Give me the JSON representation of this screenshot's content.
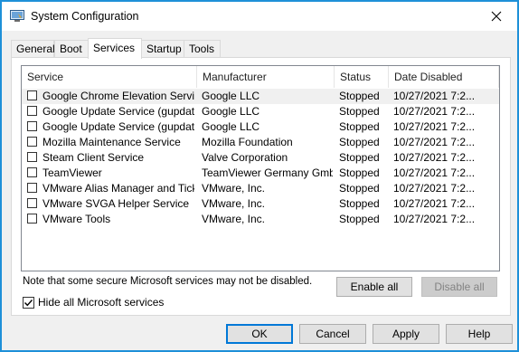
{
  "window": {
    "title": "System Configuration"
  },
  "tabs": [
    {
      "label": "General"
    },
    {
      "label": "Boot"
    },
    {
      "label": "Services"
    },
    {
      "label": "Startup"
    },
    {
      "label": "Tools"
    }
  ],
  "active_tab": "Services",
  "columns": {
    "service": "Service",
    "manufacturer": "Manufacturer",
    "status": "Status",
    "date_disabled": "Date Disabled"
  },
  "services": [
    {
      "checked": false,
      "service": "Google Chrome Elevation Servic...",
      "manufacturer": "Google LLC",
      "status": "Stopped",
      "date_disabled": "10/27/2021 7:2..."
    },
    {
      "checked": false,
      "service": "Google Update Service (gupdate)",
      "manufacturer": "Google LLC",
      "status": "Stopped",
      "date_disabled": "10/27/2021 7:2..."
    },
    {
      "checked": false,
      "service": "Google Update Service (gupdatem)",
      "manufacturer": "Google LLC",
      "status": "Stopped",
      "date_disabled": "10/27/2021 7:2..."
    },
    {
      "checked": false,
      "service": "Mozilla Maintenance Service",
      "manufacturer": "Mozilla Foundation",
      "status": "Stopped",
      "date_disabled": "10/27/2021 7:2..."
    },
    {
      "checked": false,
      "service": "Steam Client Service",
      "manufacturer": "Valve Corporation",
      "status": "Stopped",
      "date_disabled": "10/27/2021 7:2..."
    },
    {
      "checked": false,
      "service": "TeamViewer",
      "manufacturer": "TeamViewer Germany GmbH",
      "status": "Stopped",
      "date_disabled": "10/27/2021 7:2..."
    },
    {
      "checked": false,
      "service": "VMware Alias Manager and Ticke...",
      "manufacturer": "VMware, Inc.",
      "status": "Stopped",
      "date_disabled": "10/27/2021 7:2..."
    },
    {
      "checked": false,
      "service": "VMware SVGA Helper Service",
      "manufacturer": "VMware, Inc.",
      "status": "Stopped",
      "date_disabled": "10/27/2021 7:2..."
    },
    {
      "checked": false,
      "service": "VMware Tools",
      "manufacturer": "VMware, Inc.",
      "status": "Stopped",
      "date_disabled": "10/27/2021 7:2..."
    }
  ],
  "note": "Note that some secure Microsoft services may not be disabled.",
  "buttons": {
    "enable_all": "Enable all",
    "disable_all": "Disable all",
    "ok": "OK",
    "cancel": "Cancel",
    "apply": "Apply",
    "help": "Help"
  },
  "hide_ms": {
    "label": "Hide all Microsoft services",
    "checked": true
  },
  "colors": {
    "accent": "#0078d7",
    "frame": "#1e90d8"
  }
}
